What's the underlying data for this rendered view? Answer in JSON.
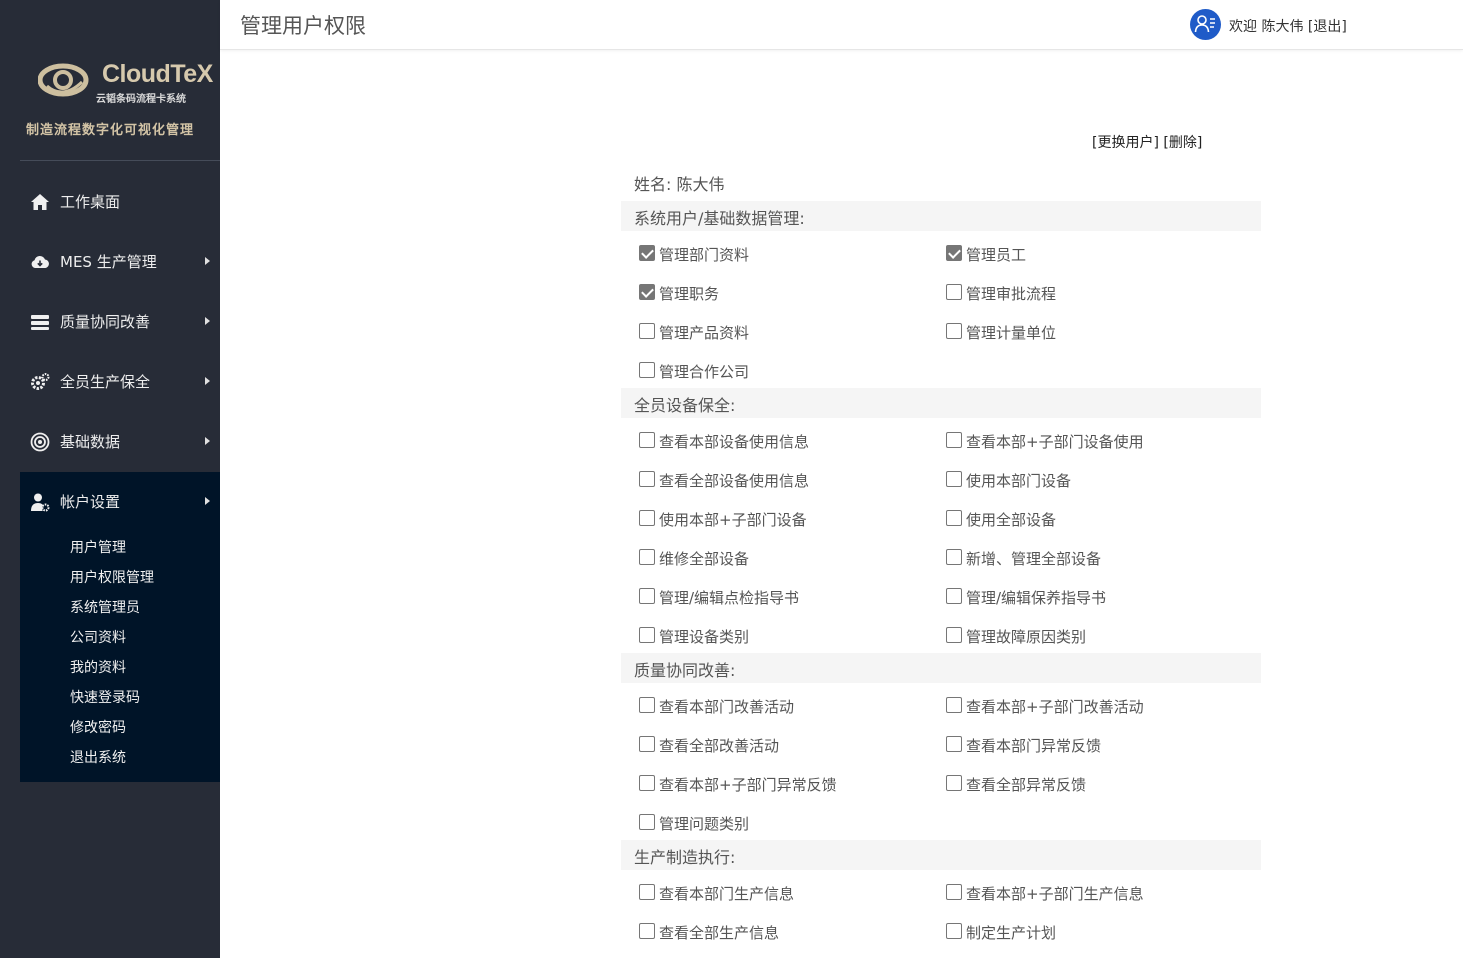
{
  "sidebar": {
    "logo": {
      "brand": "CloudTeX",
      "subtitle": "云韬条码流程卡系统"
    },
    "slogan": "制造流程数字化可视化管理",
    "nav": [
      {
        "label": "工作桌面",
        "icon": "home-icon"
      },
      {
        "label": "MES 生产管理",
        "icon": "cloud-icon"
      },
      {
        "label": "质量协同改善",
        "icon": "layers-icon"
      },
      {
        "label": "全员生产保全",
        "icon": "gears-icon"
      },
      {
        "label": "基础数据",
        "icon": "target-icon"
      },
      {
        "label": "帐户设置",
        "icon": "user-settings-icon"
      }
    ],
    "account_sub": [
      "用户管理",
      "用户权限管理",
      "系统管理员",
      "公司资料",
      "我的资料",
      "快速登录码",
      "修改密码",
      "退出系统"
    ]
  },
  "header": {
    "title": "管理用户权限",
    "welcome": "欢迎 陈大伟",
    "logout": "[退出]"
  },
  "content": {
    "change_user": "[更换用户]",
    "delete": "[删除]",
    "name_label": "姓名:",
    "name_value": "陈大伟",
    "sections": [
      {
        "title": "系统用户/基础数据管理:",
        "perms": [
          {
            "label": "管理部门资料",
            "checked": true
          },
          {
            "label": "管理员工",
            "checked": true
          },
          {
            "label": "管理职务",
            "checked": true
          },
          {
            "label": "管理审批流程",
            "checked": false
          },
          {
            "label": "管理产品资料",
            "checked": false
          },
          {
            "label": "管理计量单位",
            "checked": false
          },
          {
            "label": "管理合作公司",
            "checked": false
          }
        ]
      },
      {
        "title": "全员设备保全:",
        "perms": [
          {
            "label": "查看本部设备使用信息",
            "checked": false
          },
          {
            "label": "查看本部+子部门设备使用",
            "checked": false
          },
          {
            "label": "查看全部设备使用信息",
            "checked": false
          },
          {
            "label": "使用本部门设备",
            "checked": false
          },
          {
            "label": "使用本部+子部门设备",
            "checked": false
          },
          {
            "label": "使用全部设备",
            "checked": false
          },
          {
            "label": "维修全部设备",
            "checked": false
          },
          {
            "label": "新增、管理全部设备",
            "checked": false
          },
          {
            "label": "管理/编辑点检指导书",
            "checked": false
          },
          {
            "label": "管理/编辑保养指导书",
            "checked": false
          },
          {
            "label": "管理设备类别",
            "checked": false
          },
          {
            "label": "管理故障原因类别",
            "checked": false
          }
        ]
      },
      {
        "title": "质量协同改善:",
        "perms": [
          {
            "label": "查看本部门改善活动",
            "checked": false
          },
          {
            "label": "查看本部+子部门改善活动",
            "checked": false
          },
          {
            "label": "查看全部改善活动",
            "checked": false
          },
          {
            "label": "查看本部门异常反馈",
            "checked": false
          },
          {
            "label": "查看本部+子部门异常反馈",
            "checked": false
          },
          {
            "label": "查看全部异常反馈",
            "checked": false
          },
          {
            "label": "管理问题类别",
            "checked": false
          }
        ]
      },
      {
        "title": "生产制造执行:",
        "perms": [
          {
            "label": "查看本部门生产信息",
            "checked": false
          },
          {
            "label": "查看本部+子部门生产信息",
            "checked": false
          },
          {
            "label": "查看全部生产信息",
            "checked": false
          },
          {
            "label": "制定生产计划",
            "checked": false
          }
        ]
      }
    ]
  }
}
